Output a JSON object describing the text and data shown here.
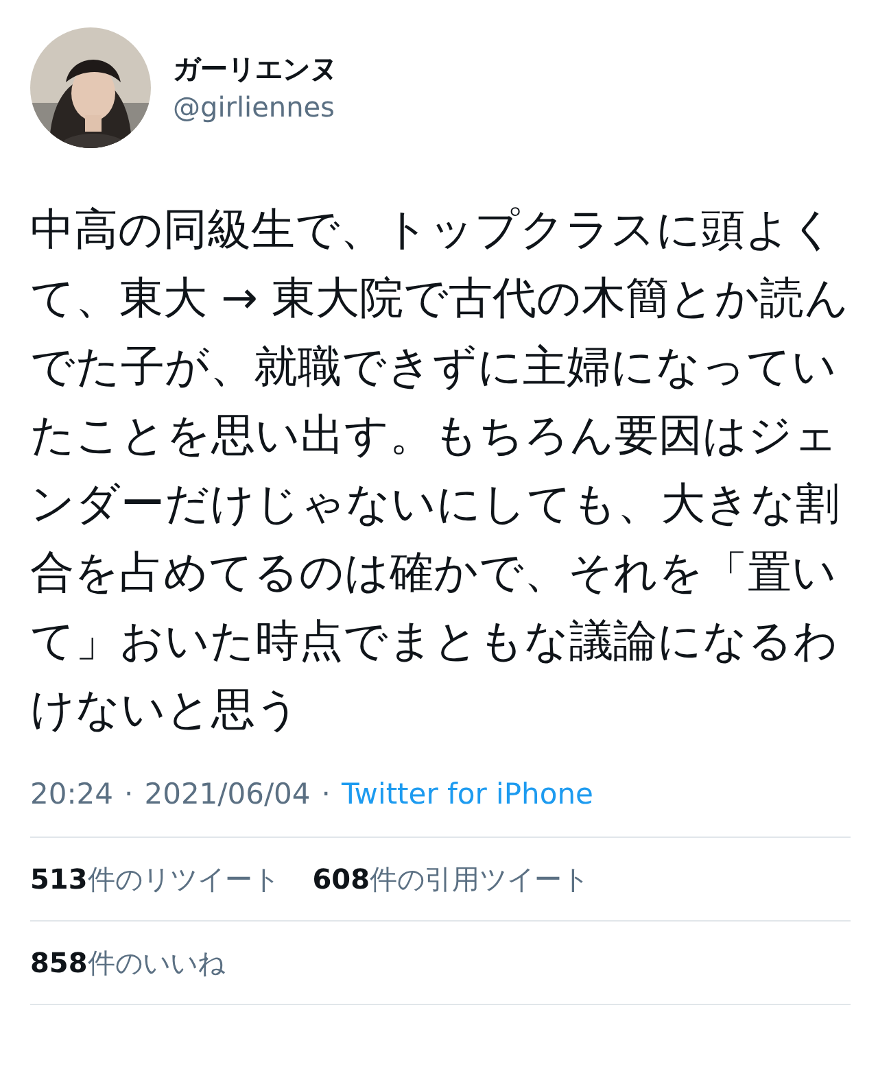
{
  "author": {
    "name": "ガーリエンヌ",
    "handle": "@girliennes"
  },
  "tweet": {
    "text": "中高の同級生で、トップクラスに頭よくて、東大 → 東大院で古代の木簡とか読んでた子が、就職できずに主婦になっていたことを思い出す。もちろん要因はジェンダーだけじゃないにしても、大きな割合を占めてるのは確かで、それを「置いて」おいた時点でまともな議論になるわけないと思う"
  },
  "meta": {
    "time": "20:24",
    "separator_1": "·",
    "date": "2021/06/04",
    "separator_2": "·",
    "source": "Twitter for iPhone"
  },
  "stats": [
    {
      "text": "**513**件のリツイート"
    },
    {
      "text": "**608**件の引用ツイート"
    },
    {
      "text": "**858**件のいいね"
    }
  ]
}
